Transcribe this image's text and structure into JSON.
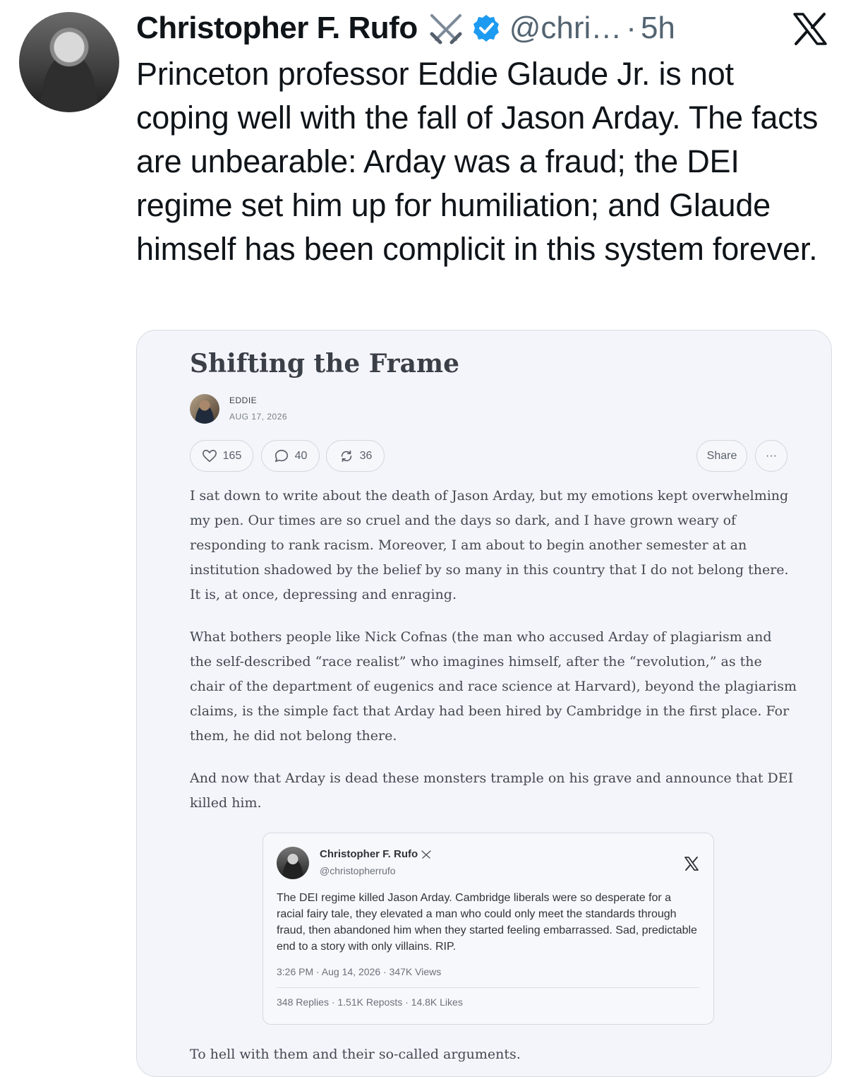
{
  "tweet": {
    "author_name": "Christopher F. Rufo",
    "handle": "@chri…",
    "separator": "·",
    "time": "5h",
    "text": "Princeton professor Eddie Glaude Jr. is not coping well with the fall of Jason Arday. The facts are unbearable: Arday was a fraud; the DEI regime set him up for humiliation; and Glaude himself has been complicit in this system forever."
  },
  "card": {
    "title": "Shifting the Frame",
    "author": "EDDIE",
    "date": "AUG 17, 2026",
    "likes": "165",
    "comments": "40",
    "restacks": "36",
    "share_label": "Share",
    "more_label": "···",
    "paragraphs": [
      "I sat down to write about the death of Jason Arday, but my emotions kept overwhelming my pen. Our times are so cruel and the days so dark, and I have grown weary of responding to rank racism. Moreover, I am about to begin another semester at an institution shadowed by the belief by so many in this country that I do not belong there. It is, at once, depressing and enraging.",
      "What bothers people like Nick Cofnas (the man who accused Arday of plagiarism and the self-described “race realist” who imagines himself, after the “revolution,” as the chair of the department of eugenics and race science at Harvard), beyond the plagiarism claims, is the simple fact that Arday had been hired by Cambridge in the first place. For them, he did not belong there.",
      "And now that Arday is dead these monsters trample on his grave and announce that DEI killed him.",
      "To hell with them and their so-called arguments."
    ],
    "embed": {
      "name": "Christopher F. Rufo",
      "handle": "@christopherrufo",
      "text": "The DEI regime killed Jason Arday. Cambridge liberals were so desperate for a racial fairy tale, they elevated a man who could only meet the standards through fraud, then abandoned him when they started feeling embarrassed. Sad, predictable end to a story with only villains. RIP.",
      "meta": "3:26 PM · Aug 14, 2026 · 347K Views",
      "stats": "348 Replies · 1.51K Reposts · 14.8K Likes"
    }
  },
  "icons": {
    "verified": "verified-badge-icon",
    "swords": "crossed-swords-icon",
    "x_logo": "x-logo-icon",
    "heart": "heart-icon",
    "comment": "comment-icon",
    "restack": "restack-icon"
  },
  "colors": {
    "verified_blue": "#1d9bf0",
    "text_primary": "#0f1419",
    "text_secondary": "#536471",
    "card_bg": "#f3f5fa"
  }
}
